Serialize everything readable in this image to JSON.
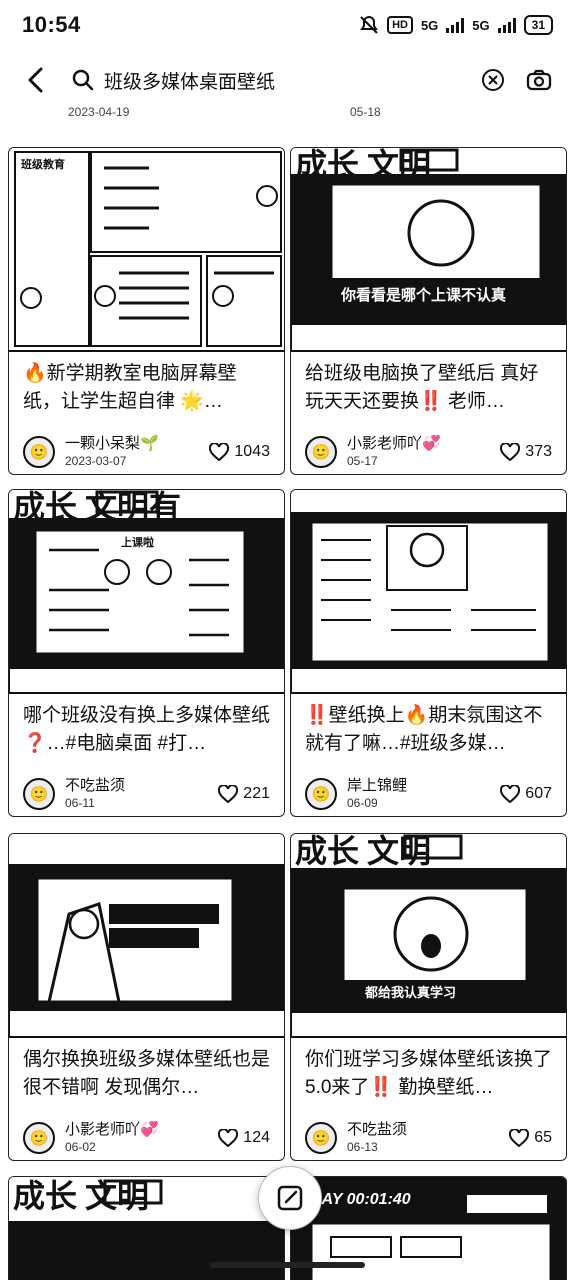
{
  "status": {
    "time": "10:54",
    "hd": "HD",
    "net1": "5G",
    "net2": "5G",
    "battery": "31"
  },
  "search": {
    "query": "班级多媒体桌面壁纸"
  },
  "prev_row": {
    "left_date": "2023-04-19",
    "right_date": "05-18"
  },
  "cards": [
    {
      "title": "🔥新学期教室电脑屏幕壁纸，让学生超自律 🌟…",
      "author": "一颗小呆梨🌱",
      "date": "2023-03-07",
      "likes": "1043",
      "image_text": {
        "banner": "",
        "caption": "班级教育"
      }
    },
    {
      "title": "给班级电脑换了壁纸后 真好玩天天还要换‼️ 老师…",
      "author": "小影老师吖💞",
      "date": "05-17",
      "likes": "373",
      "image_text": {
        "banner": "成长 文明",
        "caption": "你看看是哪个上课不认真"
      }
    },
    {
      "title": "哪个班级没有换上多媒体壁纸❓…#电脑桌面 #打…",
      "author": "不吃盐须",
      "date": "06-11",
      "likes": "221",
      "image_text": {
        "banner": "成长 文明有",
        "caption": "上课啦"
      }
    },
    {
      "title": "‼️壁纸换上🔥期末氛围这不就有了嘛…#班级多媒…",
      "author": "岸上锦鲤",
      "date": "06-09",
      "likes": "607",
      "image_text": {
        "banner": "",
        "caption": ""
      }
    },
    {
      "title": "偶尔换换班级多媒体壁纸也是很不错啊 发现偶尔…",
      "author": "小影老师吖💞",
      "date": "06-02",
      "likes": "124",
      "image_text": {
        "banner": "",
        "caption": ""
      }
    },
    {
      "title": "你们班学习多媒体壁纸该换了5.0来了‼️ 勤换壁纸…",
      "author": "不吃盐须",
      "date": "06-13",
      "likes": "65",
      "image_text": {
        "banner": "成长 文明",
        "caption": "都给我认真学习"
      }
    }
  ],
  "bottom_row": {
    "left_banner": "成长 文明",
    "right_banner": "PLAY 00:01:40"
  }
}
